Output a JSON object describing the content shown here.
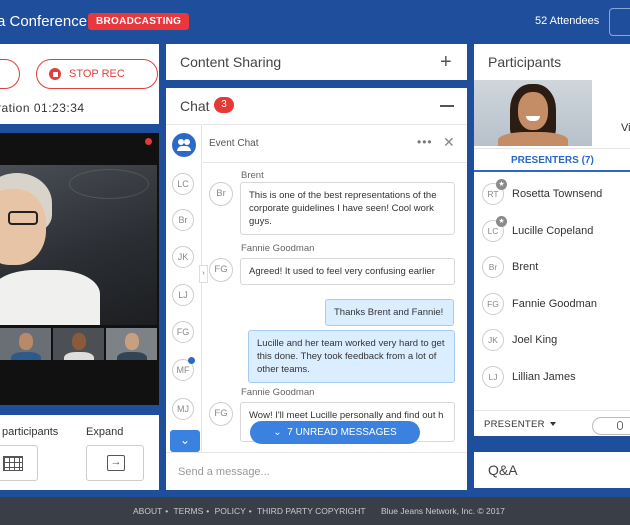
{
  "header": {
    "conference_title": "a Conference",
    "broadcast_badge": "BROADCASTING",
    "attendees": "52 Attendees"
  },
  "controls": {
    "stop_rec_label": "STOP REC",
    "duration": "ration 01:23:34"
  },
  "left_bottom": {
    "participants_label": "participants",
    "expand_label": "Expand"
  },
  "content_sharing": {
    "title": "Content Sharing"
  },
  "chat": {
    "title": "Chat",
    "count": "3",
    "event_chat_label": "Event Chat",
    "list_avatars": [
      "LC",
      "Br",
      "JK",
      "LJ",
      "FG",
      "MF",
      "MJ"
    ],
    "messages": [
      {
        "sender": "Brent",
        "initials": "Br",
        "text": "This is one of the best representations of the corporate guidelines I have seen! Cool work guys."
      },
      {
        "sender": "Fannie Goodman",
        "initials": "FG",
        "text": "Agreed! It used to feel very confusing earlier"
      },
      {
        "outgoing": true,
        "text": "Thanks Brent and Fannie!"
      },
      {
        "outgoing": true,
        "text": "Lucille and her team worked very hard to get this done. They took feedback from a lot of other teams."
      },
      {
        "sender": "Fannie Goodman",
        "initials": "FG",
        "text": "Wow! I'll meet Lucille personally and find out h"
      }
    ],
    "unread_pill": "7 UNREAD MESSAGES",
    "input_placeholder": "Send a message..."
  },
  "participants": {
    "title": "Participants",
    "video_label": "Vi",
    "presenters_tab": "PRESENTERS (7)",
    "presenters": [
      {
        "initials": "RT",
        "name": "Rosetta Townsend",
        "star": true
      },
      {
        "initials": "LC",
        "name": "Lucille Copeland",
        "star": true
      },
      {
        "initials": "Br",
        "name": "Brent",
        "star": false
      },
      {
        "initials": "FG",
        "name": "Fannie Goodman",
        "star": false
      },
      {
        "initials": "JK",
        "name": "Joel King",
        "star": false
      },
      {
        "initials": "LJ",
        "name": "Lillian James",
        "star": false
      }
    ],
    "role_select": "PRESENTER"
  },
  "qa": {
    "title": "Q&A"
  },
  "footer": {
    "links": [
      "ABOUT",
      "TERMS",
      "POLICY",
      "THIRD PARTY COPYRIGHT"
    ],
    "copyright": "Blue Jeans Network, Inc. © 2017"
  },
  "colors": {
    "brand_blue": "#1f4e9c",
    "accent_blue": "#2b68c8",
    "alert_red": "#e53935"
  }
}
